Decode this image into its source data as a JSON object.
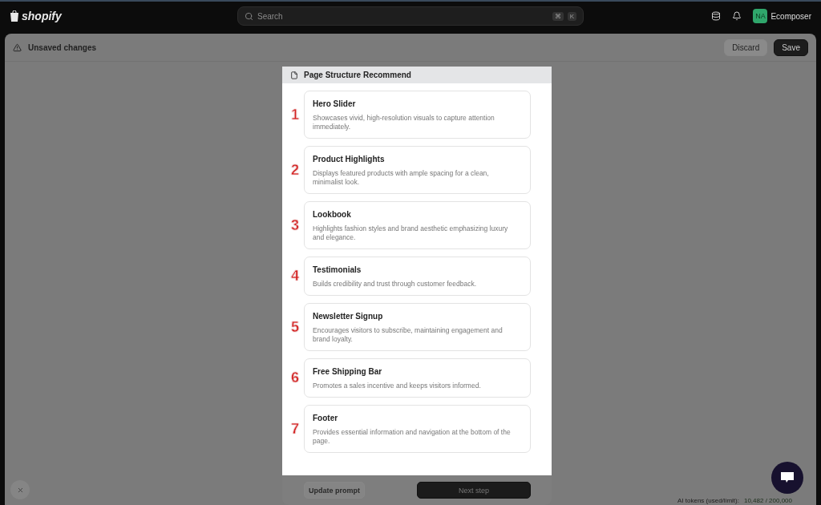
{
  "top_bar": {
    "logo": "shopify",
    "search": {
      "placeholder": "Search",
      "keys": [
        "⌘",
        "K"
      ]
    },
    "avatar": "NA",
    "store": "Ecomposer"
  },
  "save_bar": {
    "message": "Unsaved changes",
    "buttons": [
      {
        "label": "Discard",
        "kind": "secondary"
      },
      {
        "label": "Save",
        "kind": "primary"
      }
    ]
  },
  "modal": {
    "title": "Page Structure Recommend",
    "sections": [
      {
        "number": "1",
        "title": "Hero Slider",
        "description": "Showcases vivid, high-resolution visuals to capture attention immediately."
      },
      {
        "number": "2",
        "title": "Product Highlights",
        "description": "Displays featured products with ample spacing for a clean, minimalist look."
      },
      {
        "number": "3",
        "title": "Lookbook",
        "description": "Highlights fashion styles and brand aesthetic emphasizing luxury and elegance."
      },
      {
        "number": "4",
        "title": "Testimonials",
        "description": "Builds credibility and trust through customer feedback."
      },
      {
        "number": "5",
        "title": "Newsletter Signup",
        "description": "Encourages visitors to subscribe, maintaining engagement and brand loyalty."
      },
      {
        "number": "6",
        "title": "Free Shipping Bar",
        "description": "Promotes a sales incentive and keeps visitors informed."
      },
      {
        "number": "7",
        "title": "Footer",
        "description": "Provides essential information and navigation at the bottom of the page."
      }
    ],
    "buttons": [
      {
        "label": "Update prompt",
        "kind": "secondary"
      },
      {
        "label": "Next step",
        "kind": "primary"
      }
    ]
  },
  "tokens": {
    "label": "AI tokens (used/limit):",
    "value": "10,482 / 200,000"
  }
}
